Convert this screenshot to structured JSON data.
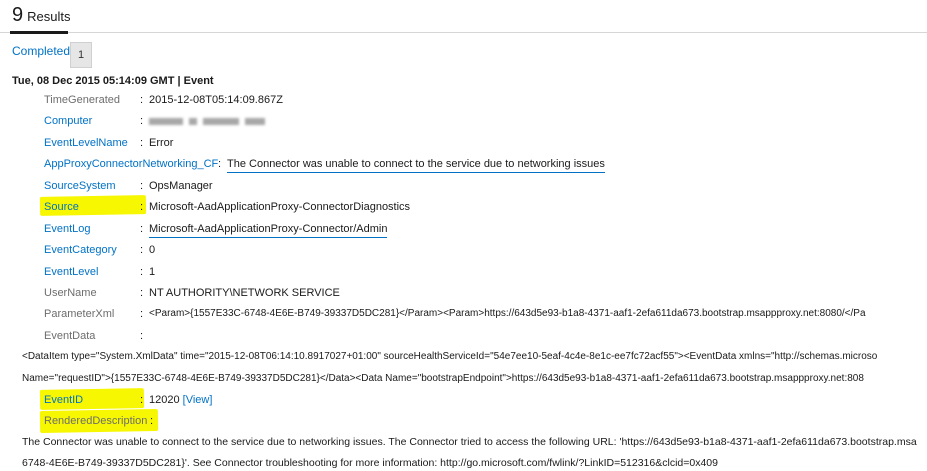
{
  "header": {
    "count": "9",
    "label": "Results"
  },
  "tabs": {
    "completed_label": "Completed",
    "badge": "1"
  },
  "event": {
    "title": "Tue, 08 Dec 2015 05:14:09 GMT | Event",
    "fields": {
      "time_generated": {
        "name": "TimeGenerated",
        "value": "2015-12-08T05:14:09.867Z"
      },
      "computer": {
        "name": "Computer"
      },
      "event_level_name": {
        "name": "EventLevelName",
        "value": "Error"
      },
      "app_proxy": {
        "name": "AppProxyConnectorNetworking_CF",
        "value": "The Connector was unable to connect to the service due to networking issues"
      },
      "source_system": {
        "name": "SourceSystem",
        "value": "OpsManager"
      },
      "source": {
        "name": "Source",
        "value": "Microsoft-AadApplicationProxy-ConnectorDiagnostics"
      },
      "event_log": {
        "name": "EventLog",
        "value": "Microsoft-AadApplicationProxy-Connector/Admin"
      },
      "event_category": {
        "name": "EventCategory",
        "value": "0"
      },
      "event_level": {
        "name": "EventLevel",
        "value": "1"
      },
      "user_name": {
        "name": "UserName",
        "value": "NT AUTHORITY\\NETWORK SERVICE"
      },
      "parameter_xml": {
        "name": "ParameterXml",
        "value": "<Param>{1557E33C-6748-4E6E-B749-39337D5DC281}</Param><Param>https://643d5e93-b1a8-4371-aaf1-2efa611da673.bootstrap.msappproxy.net:8080/</Pa"
      },
      "event_data": {
        "name": "EventData",
        "value": ""
      },
      "event_id": {
        "name": "EventID",
        "value": "12020",
        "link": "[View]"
      },
      "rendered_description": {
        "name": "RenderedDescription"
      }
    },
    "event_data_line1": "<DataItem type=\"System.XmlData\" time=\"2015-12-08T06:14:10.8917027+01:00\" sourceHealthServiceId=\"54e7ee10-5eaf-4c4e-8e1c-ee7fc72acf55\"><EventData xmlns=\"http://schemas.microso",
    "event_data_line2": "Name=\"requestID\">{1557E33C-6748-4E6E-B749-39337D5DC281}</Data><Data Name=\"bootstrapEndpoint\">https://643d5e93-b1a8-4371-aaf1-2efa611da673.bootstrap.msappproxy.net:808",
    "description_line1": "The Connector was unable to connect to the service due to networking issues. The Connector tried to access the following URL: 'https://643d5e93-b1a8-4371-aaf1-2efa611da673.bootstrap.msa",
    "description_line2": "6748-4E6E-B749-39337D5DC281}'. See Connector troubleshooting for more information: http://go.microsoft.com/fwlink/?LinkID=512316&clcid=0x409"
  },
  "colors": {
    "link": "#0072c6",
    "highlight": "#f6f700",
    "muted": "#6d6d6d"
  }
}
